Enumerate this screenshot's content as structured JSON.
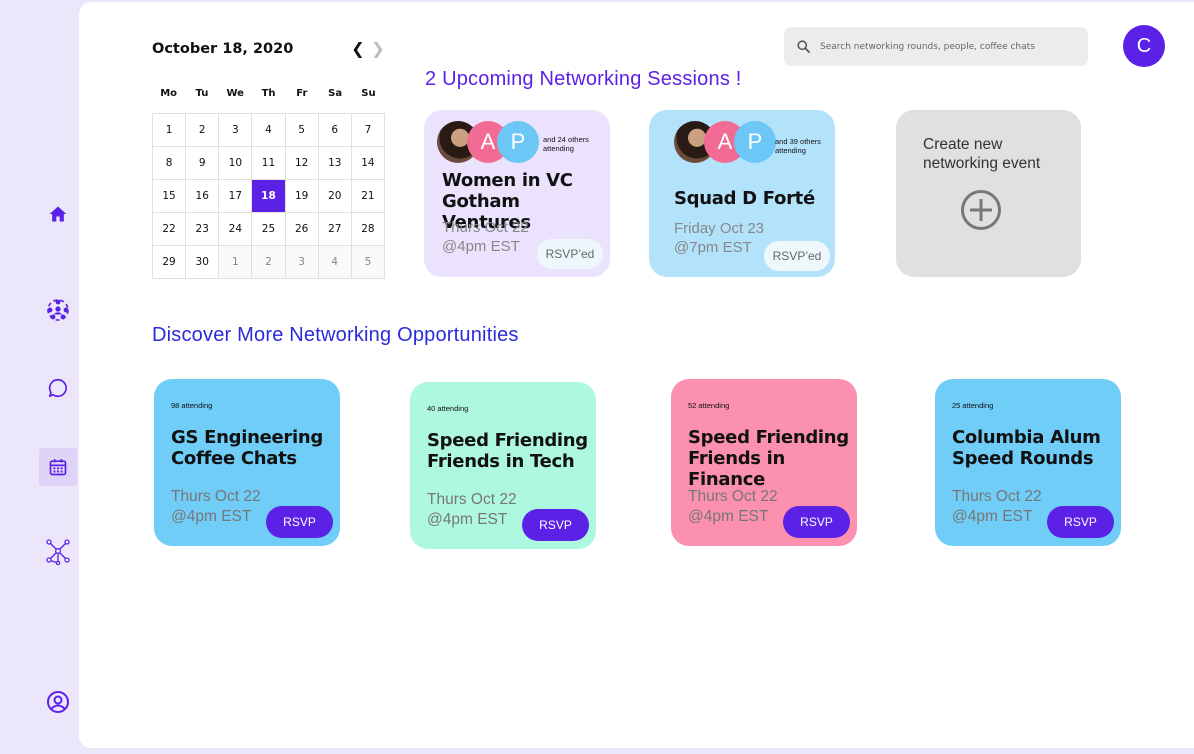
{
  "colors": {
    "accent": "#5b21e6",
    "sidebar_bg": "#ece6fb",
    "card_purple": "#ebe2fd",
    "card_blue": "#b3e3fb",
    "card_grey": "#e0e0e0",
    "discover_blue": "#6fcdf7",
    "discover_mint": "#aef7e0",
    "discover_pink": "#fb91ae",
    "discover_title": "#2b2bd9"
  },
  "sidebar": {
    "items": [
      {
        "icon": "home-icon",
        "active": false
      },
      {
        "icon": "people-group-icon",
        "active": false
      },
      {
        "icon": "chat-bubble-icon",
        "active": false
      },
      {
        "icon": "calendar-icon",
        "active": true
      },
      {
        "icon": "network-icon",
        "active": false
      },
      {
        "icon": "profile-icon",
        "active": false
      }
    ]
  },
  "calendar": {
    "title": "October 18, 2020",
    "weekdays": [
      "Mo",
      "Tu",
      "We",
      "Th",
      "Fr",
      "Sa",
      "Su"
    ],
    "selected_day": "18",
    "days": [
      {
        "d": "1"
      },
      {
        "d": "2"
      },
      {
        "d": "3"
      },
      {
        "d": "4"
      },
      {
        "d": "5"
      },
      {
        "d": "6"
      },
      {
        "d": "7"
      },
      {
        "d": "8"
      },
      {
        "d": "9"
      },
      {
        "d": "10"
      },
      {
        "d": "11"
      },
      {
        "d": "12"
      },
      {
        "d": "13"
      },
      {
        "d": "14"
      },
      {
        "d": "15"
      },
      {
        "d": "16"
      },
      {
        "d": "17"
      },
      {
        "d": "18"
      },
      {
        "d": "19"
      },
      {
        "d": "20"
      },
      {
        "d": "21"
      },
      {
        "d": "22"
      },
      {
        "d": "23"
      },
      {
        "d": "24"
      },
      {
        "d": "25"
      },
      {
        "d": "26"
      },
      {
        "d": "27"
      },
      {
        "d": "28"
      },
      {
        "d": "29"
      },
      {
        "d": "30"
      },
      {
        "d": "1",
        "muted": true
      },
      {
        "d": "2",
        "muted": true
      },
      {
        "d": "3",
        "muted": true
      },
      {
        "d": "4",
        "muted": true
      },
      {
        "d": "5",
        "muted": true
      }
    ]
  },
  "search": {
    "placeholder": "Search networking rounds, people, coffee chats"
  },
  "user": {
    "initial": "C"
  },
  "upcoming": {
    "title": "2 Upcoming Networking Sessions !",
    "cards": [
      {
        "avatar_a": "A",
        "avatar_p": "P",
        "others": "and 24 others attending",
        "name_line1": "Women in VC",
        "name_line2": "Gotham Ventures",
        "date_line1": "Thurs Oct 22",
        "date_line2": "@4pm EST",
        "status": "RSVP’ed"
      },
      {
        "avatar_a": "A",
        "avatar_p": "P",
        "others": "and 39 others attending",
        "name_line1": "Squad D Forté",
        "date_line1": "Friday Oct 23",
        "date_line2": "@7pm EST",
        "status": "RSVP’ed"
      }
    ],
    "create": {
      "label": "Create new networking event"
    }
  },
  "discover": {
    "title": "Discover More Networking Opportunities",
    "cards": [
      {
        "attending": "98 attending",
        "name_line1": "GS Engineering",
        "name_line2": "Coffee Chats",
        "date_line1": "Thurs Oct 22",
        "date_line2": "@4pm EST",
        "button": "RSVP"
      },
      {
        "attending": "40 attending",
        "name_line1": "Speed Friending",
        "name_line2": "Friends in Tech",
        "date_line1": "Thurs Oct 22",
        "date_line2": "@4pm EST",
        "button": "RSVP"
      },
      {
        "attending": "52 attending",
        "name_line1": "Speed Friending",
        "name_line2": "Friends in Finance",
        "date_line1": "Thurs Oct 22",
        "date_line2": "@4pm EST",
        "button": "RSVP"
      },
      {
        "attending": "25 attending",
        "name_line1": "Columbia Alum",
        "name_line2": "Speed Rounds",
        "date_line1": "Thurs Oct 22",
        "date_line2": "@4pm EST",
        "button": "RSVP"
      }
    ]
  }
}
